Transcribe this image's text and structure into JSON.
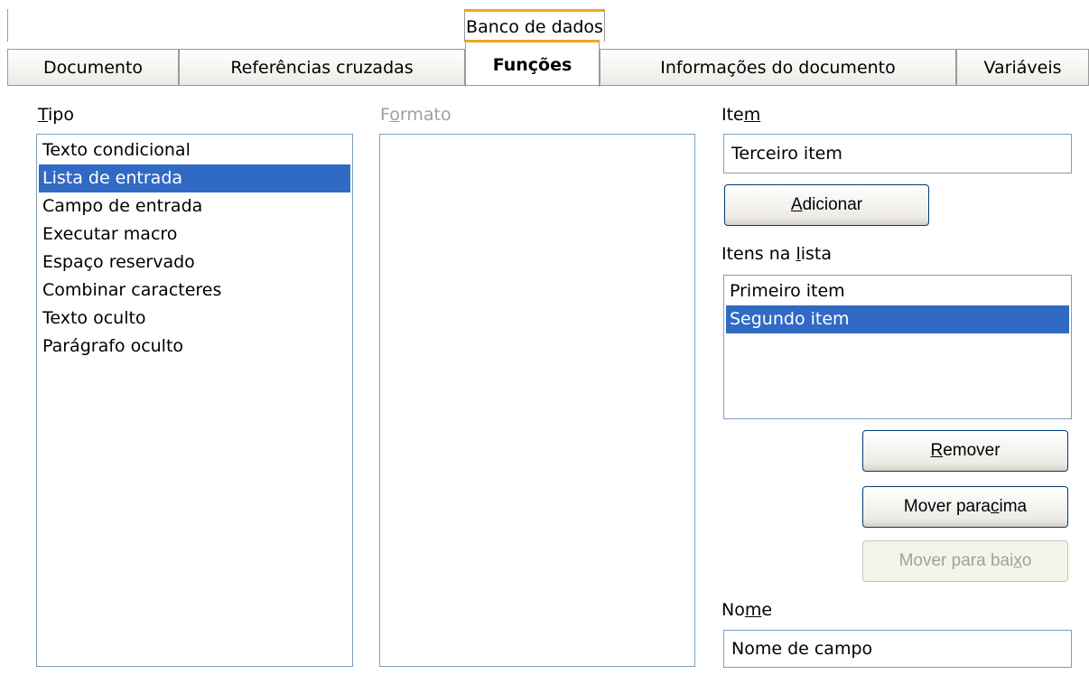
{
  "tabs": {
    "top_row": [
      "Banco de dados"
    ],
    "bottom_row": [
      "Documento",
      "Referências cruzadas",
      "Funções",
      "Informações do documento",
      "Variáveis"
    ],
    "active": "Funções"
  },
  "tipo": {
    "label": "Tipo",
    "items": [
      "Texto condicional",
      "Lista de entrada",
      "Campo de entrada",
      "Executar macro",
      "Espaço reservado",
      "Combinar caracteres",
      "Texto oculto",
      "Parágrafo oculto"
    ],
    "selected_index": 1
  },
  "formato": {
    "label": "Formato",
    "items": []
  },
  "item": {
    "label": "Item",
    "value": "Terceiro item"
  },
  "buttons": {
    "add": "Adicionar",
    "remove": "Remover",
    "move_up": "Mover para cima",
    "move_down": "Mover para baixo"
  },
  "list_items": {
    "label": "Itens na lista",
    "items": [
      "Primeiro item",
      "Segundo item"
    ],
    "selected_index": 1
  },
  "nome": {
    "label": "Nome",
    "value": "Nome de campo"
  }
}
